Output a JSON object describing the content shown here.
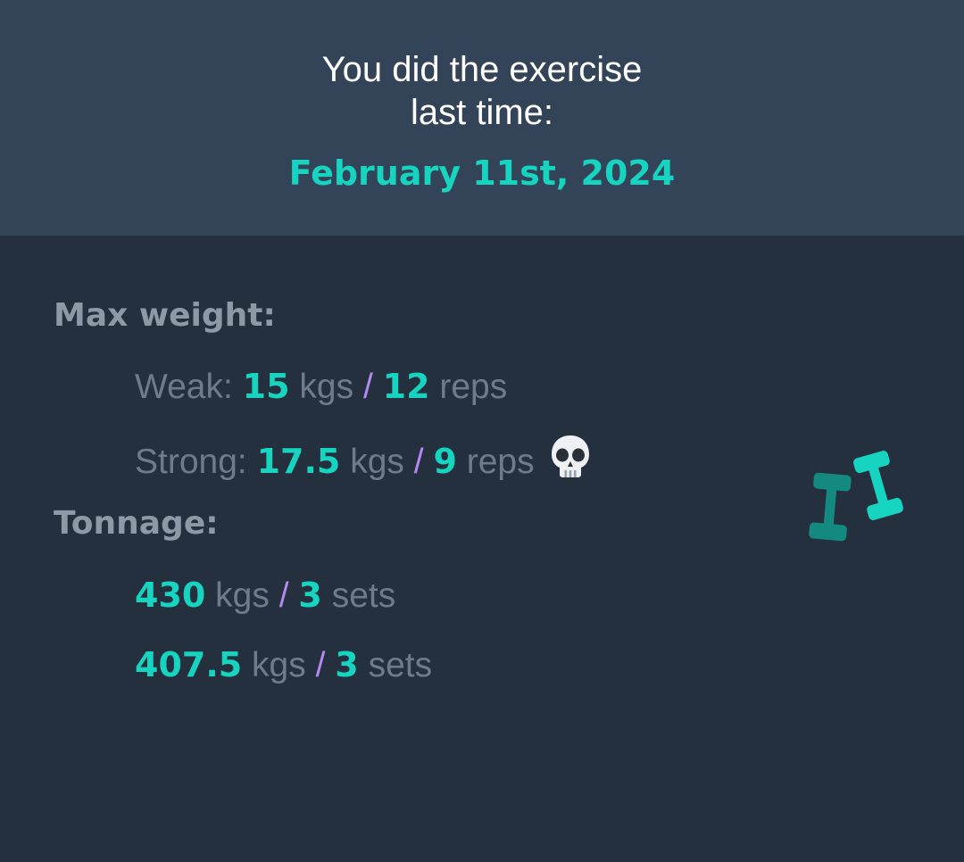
{
  "header": {
    "line1": "You did the exercise",
    "line2": "last time:",
    "date": "February 11st, 2024"
  },
  "max_weight": {
    "title": "Max weight:",
    "weak": {
      "label": "Weak:",
      "weight": "15",
      "weight_unit": "kgs",
      "separator": "/",
      "reps": "12",
      "reps_unit": "reps"
    },
    "strong": {
      "label": "Strong:",
      "weight": "17.5",
      "weight_unit": "kgs",
      "separator": "/",
      "reps": "9",
      "reps_unit": "reps",
      "icon": "skull-icon"
    }
  },
  "tonnage": {
    "title": "Tonnage:",
    "rows": [
      {
        "weight": "430",
        "weight_unit": "kgs",
        "separator": "/",
        "sets": "3",
        "sets_unit": "sets"
      },
      {
        "weight": "407.5",
        "weight_unit": "kgs",
        "separator": "/",
        "sets": "3",
        "sets_unit": "sets"
      }
    ]
  },
  "decoration": {
    "icon": "dumbbells-icon"
  },
  "colors": {
    "header_bg": "#334358",
    "body_bg": "#24303e",
    "accent": "#17d4c0",
    "separator": "#b48af0",
    "muted_text": "#6f7b89",
    "section_title": "#8f99a6"
  }
}
